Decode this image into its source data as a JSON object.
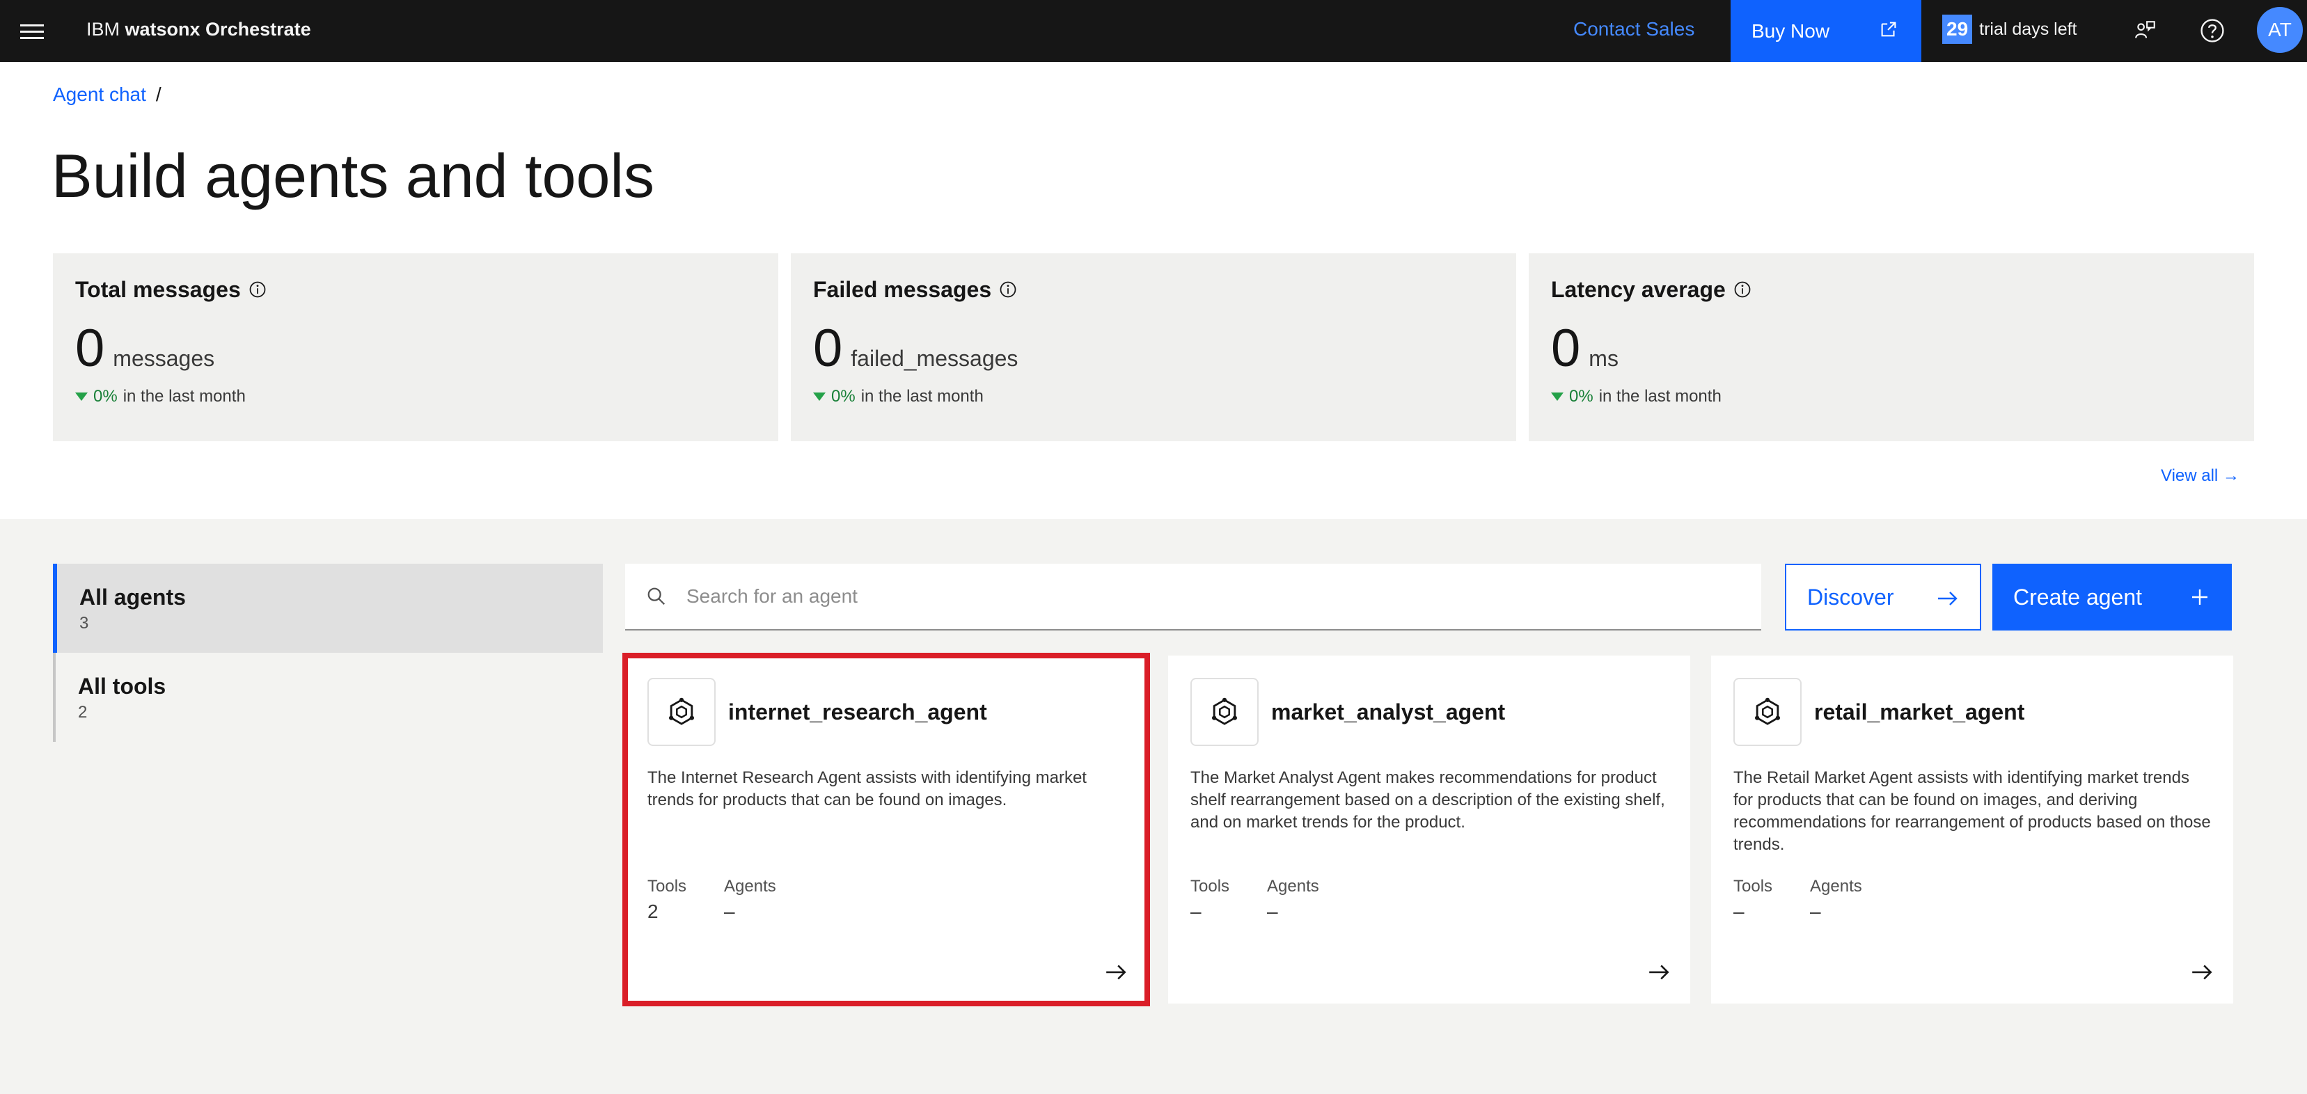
{
  "header": {
    "brand_prefix": "IBM",
    "brand_name": "watsonx Orchestrate",
    "contact_sales": "Contact Sales",
    "buy_now": "Buy Now",
    "trial_days": "29",
    "trial_text": "trial days left",
    "avatar_initials": "AT"
  },
  "breadcrumb": {
    "item": "Agent chat",
    "separator": "/"
  },
  "page_title": "Build agents and tools",
  "stats": [
    {
      "title": "Total messages",
      "value": "0",
      "unit": "messages",
      "trend_pct": "0%",
      "trend_text": "in the last month"
    },
    {
      "title": "Failed messages",
      "value": "0",
      "unit": "failed_messages",
      "trend_pct": "0%",
      "trend_text": "in the last month"
    },
    {
      "title": "Latency average",
      "value": "0",
      "unit": "ms",
      "trend_pct": "0%",
      "trend_text": "in the last month"
    }
  ],
  "view_all": "View all →",
  "sidebar": {
    "items": [
      {
        "label": "All agents",
        "count": "3"
      },
      {
        "label": "All tools",
        "count": "2"
      }
    ]
  },
  "search": {
    "placeholder": "Search for an agent"
  },
  "buttons": {
    "discover": "Discover",
    "create_agent": "Create agent"
  },
  "agents": [
    {
      "name": "internet_research_agent",
      "description": "The Internet Research Agent assists with identifying market trends for products that can be found on images.",
      "tools_label": "Tools",
      "tools_value": "2",
      "agents_label": "Agents",
      "agents_value": "–"
    },
    {
      "name": "market_analyst_agent",
      "description": "The Market Analyst Agent makes recommendations for product shelf rearrangement based on a description of the existing shelf, and on market trends for the product.",
      "tools_label": "Tools",
      "tools_value": "–",
      "agents_label": "Agents",
      "agents_value": "–"
    },
    {
      "name": "retail_market_agent",
      "description": "The Retail Market Agent assists with identifying market trends for products that can be found on images, and deriving recommendations for rearrangement of products based on those trends.",
      "tools_label": "Tools",
      "tools_value": "–",
      "agents_label": "Agents",
      "agents_value": "–"
    }
  ],
  "colors": {
    "accent": "#0f62fe",
    "header_bg": "#161616",
    "selection_outline": "#da1e28",
    "trend_green": "#24a148"
  }
}
